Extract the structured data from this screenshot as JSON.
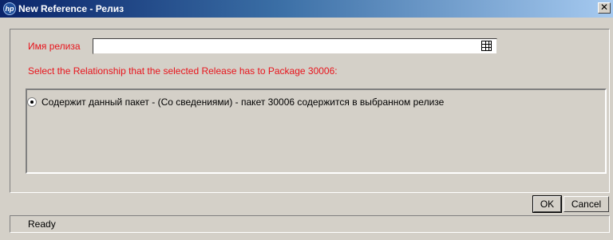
{
  "window": {
    "title": "New Reference - Релиз",
    "app_icon_text": "hp",
    "close_glyph": "✕"
  },
  "form": {
    "release_label": "Имя релиза",
    "release_value": "",
    "instruction": "Select the Relationship that the selected Release has to Package 30006:",
    "relationship_option": {
      "label": "Содержит данный пакет - (Со сведениями) - пакет 30006 содержится в выбранном релизе",
      "selected": true
    }
  },
  "buttons": {
    "ok_label": "OK",
    "cancel_label": "Cancel"
  },
  "status": {
    "text": "Ready"
  },
  "colors": {
    "label_red": "#e8141c",
    "title_bar": "#0a246a",
    "window_bg": "#d4d0c8"
  },
  "icons": {
    "picker": "table-grid-icon"
  }
}
